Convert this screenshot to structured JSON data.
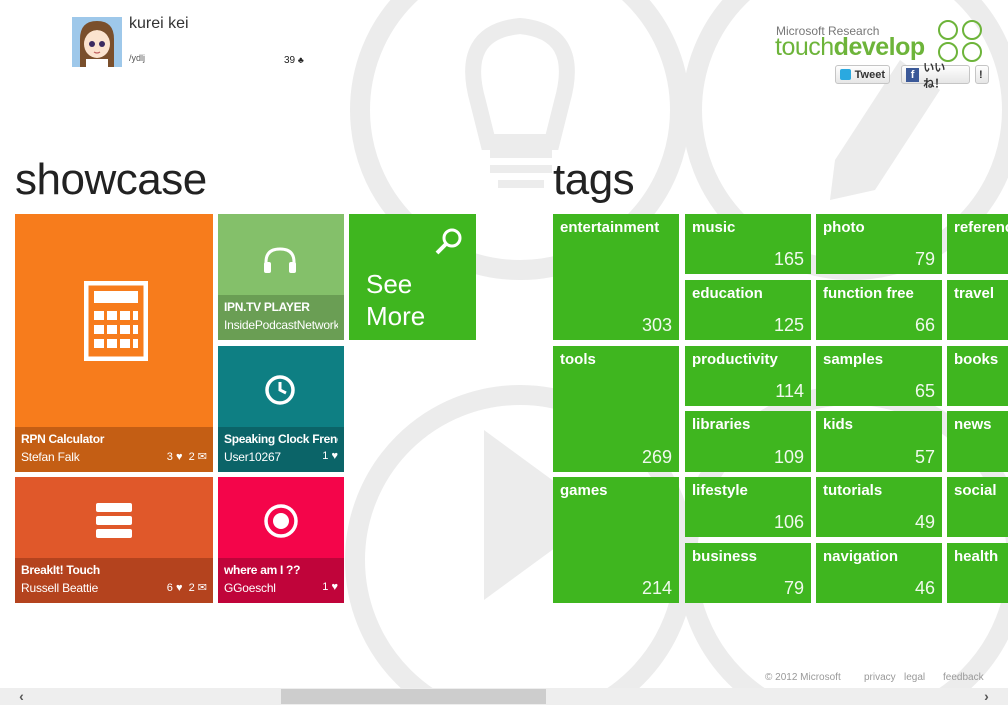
{
  "user": {
    "name": "kurei kei",
    "id": "/ydlj",
    "score": "39",
    "score_icon": "award-icon"
  },
  "brand": {
    "top": "Microsoft Research",
    "main_light": "touch",
    "main_bold": "develop",
    "color": "#6db43a"
  },
  "social": {
    "tweet": "Tweet",
    "like": "いいね！",
    "like_count": "!"
  },
  "showcase": {
    "title": "showcase",
    "tiles": [
      {
        "name": "RPN Calculator",
        "author": "Stefan Falk",
        "hearts": "3",
        "comments": "2",
        "icon": "calculator-icon",
        "color": "#f77c1c"
      },
      {
        "name": "IPN.TV PLAYER",
        "author": "InsidePodcastNetwork",
        "icon": "headphones-icon",
        "color": "#84c06a"
      },
      {
        "name": "Speaking Clock French",
        "author": "User10267",
        "hearts": "1",
        "icon": "clock-icon",
        "color": "#0e7f83"
      },
      {
        "name": "BreakIt! Touch",
        "author": "Russell Beattie",
        "hearts": "6",
        "comments": "2",
        "icon": "menu-bars-icon",
        "color": "#e0582a"
      },
      {
        "name": "where am I ??",
        "author": "GGoeschl",
        "hearts": "1",
        "icon": "record-icon",
        "color": "#f4054a"
      }
    ],
    "see_more": {
      "line1": "See",
      "line2": "More",
      "icon": "search-icon",
      "color": "#3fb61f"
    }
  },
  "tags": {
    "title": "tags",
    "color": "#3fb61f",
    "items": [
      {
        "name": "entertainment",
        "count": "303"
      },
      {
        "name": "music",
        "count": "165"
      },
      {
        "name": "photo",
        "count": "79"
      },
      {
        "name": "reference",
        "count": ""
      },
      {
        "name": "education",
        "count": "125"
      },
      {
        "name": "function free",
        "count": "66"
      },
      {
        "name": "travel",
        "count": ""
      },
      {
        "name": "tools",
        "count": "269"
      },
      {
        "name": "productivity",
        "count": "114"
      },
      {
        "name": "samples",
        "count": "65"
      },
      {
        "name": "books",
        "count": ""
      },
      {
        "name": "libraries",
        "count": "109"
      },
      {
        "name": "kids",
        "count": "57"
      },
      {
        "name": "news",
        "count": ""
      },
      {
        "name": "games",
        "count": "214"
      },
      {
        "name": "lifestyle",
        "count": "106"
      },
      {
        "name": "tutorials",
        "count": "49"
      },
      {
        "name": "social",
        "count": ""
      },
      {
        "name": "business",
        "count": "79"
      },
      {
        "name": "navigation",
        "count": "46"
      },
      {
        "name": "health",
        "count": ""
      }
    ]
  },
  "footer": {
    "copyright": "© 2012 Microsoft",
    "privacy": "privacy",
    "legal": "legal",
    "feedback": "feedback"
  }
}
